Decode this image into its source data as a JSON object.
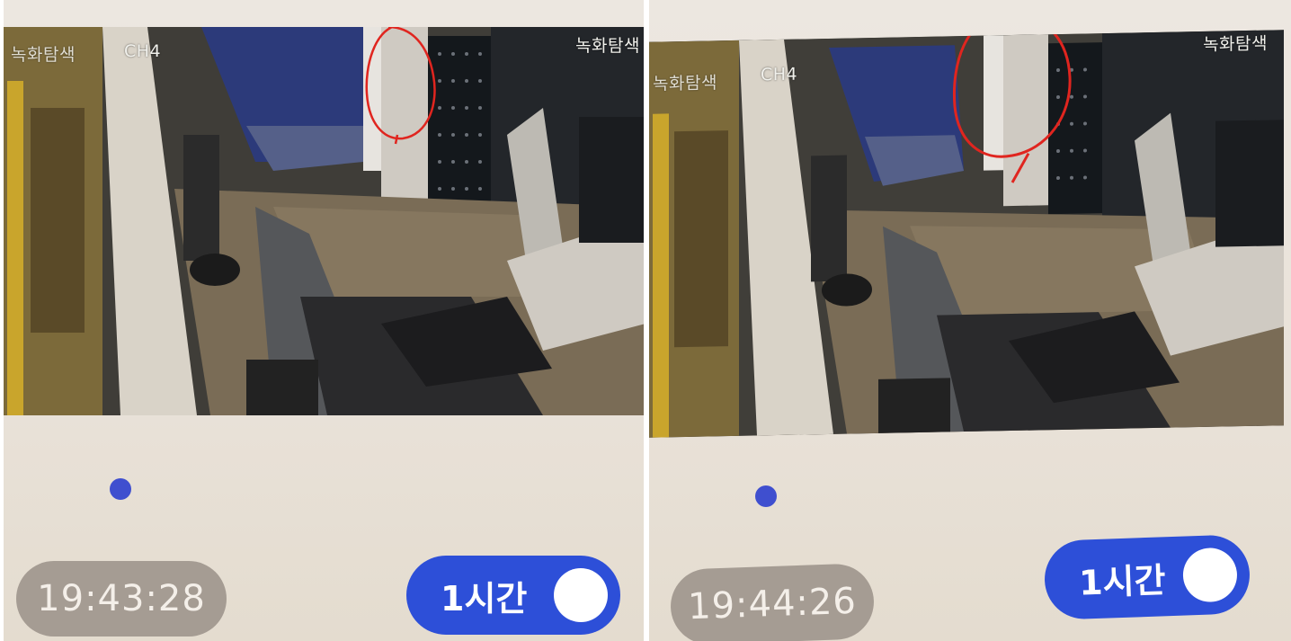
{
  "panels": [
    {
      "channel": "CH4",
      "left_overlay": "녹화탐색",
      "search_label": "녹화탐색",
      "timestamp": "19:43:28",
      "range_toggle": {
        "label": "1시간",
        "on": true
      }
    },
    {
      "channel": "CH4",
      "left_overlay": "녹화탐색",
      "search_label": "녹화탐색",
      "timestamp": "19:44:26",
      "range_toggle": {
        "label": "1시간",
        "on": true
      }
    }
  ],
  "colors": {
    "accent": "#2d4fd8",
    "record_dot": "#3f4fcf",
    "time_pill": "#a59c93",
    "annotation": "#e0251f"
  },
  "icons": [
    "record-dot-icon",
    "toggle-knob-icon",
    "annotation-circle-icon"
  ]
}
